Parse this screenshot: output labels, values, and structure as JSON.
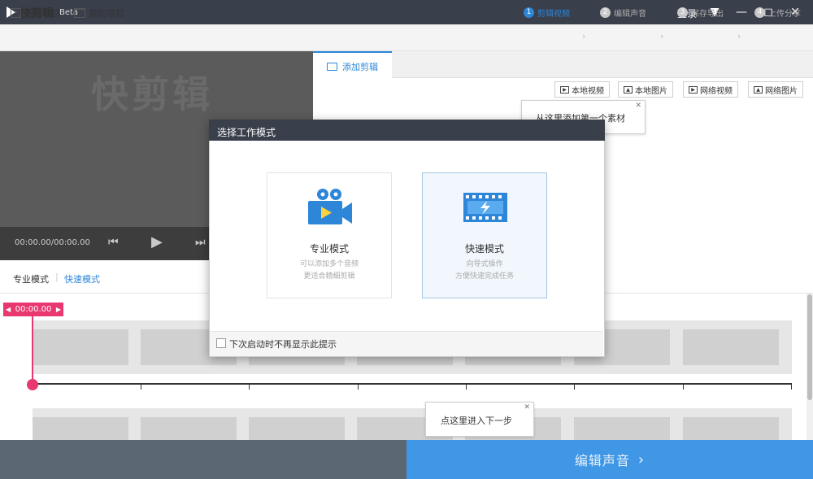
{
  "titlebar": {
    "app_name": "快剪辑",
    "badge": "Beta",
    "login": "登录"
  },
  "menubar": {
    "new_project": "新建项目",
    "my_projects": "我的项目"
  },
  "steps": [
    {
      "num": "1",
      "label": "剪辑视频",
      "active": true
    },
    {
      "num": "2",
      "label": "编辑声音",
      "active": false
    },
    {
      "num": "3",
      "label": "保存导出",
      "active": false
    },
    {
      "num": "4",
      "label": "上传分享",
      "active": false
    }
  ],
  "preview": {
    "watermark": "快剪辑",
    "time": "00:00.00/00:00.00"
  },
  "panel": {
    "tab_label": "添加剪辑",
    "sources": [
      "本地视频",
      "本地图片",
      "网络视频",
      "网络图片"
    ],
    "tooltip_add": "从这里添加第一个素材"
  },
  "mode_tabs": {
    "pro": "专业模式",
    "sep": "|",
    "quick": "快速模式"
  },
  "timeline": {
    "marker_time": "00:00.00"
  },
  "modal": {
    "title": "选择工作模式",
    "cards": [
      {
        "title": "专业模式",
        "desc1": "可以添加多个音频",
        "desc2": "更适合精细剪辑",
        "selected": false
      },
      {
        "title": "快速模式",
        "desc1": "向导式操作",
        "desc2": "方便快速完成任务",
        "selected": true
      }
    ],
    "checkbox_label": "下次启动时不再显示此提示"
  },
  "tooltip_next": "点这里进入下一步",
  "next_button": "编辑声音",
  "colors": {
    "accent": "#2d86d8",
    "titlebar": "#3a3f4c",
    "marker": "#e8386f",
    "next": "#3f97e6"
  }
}
